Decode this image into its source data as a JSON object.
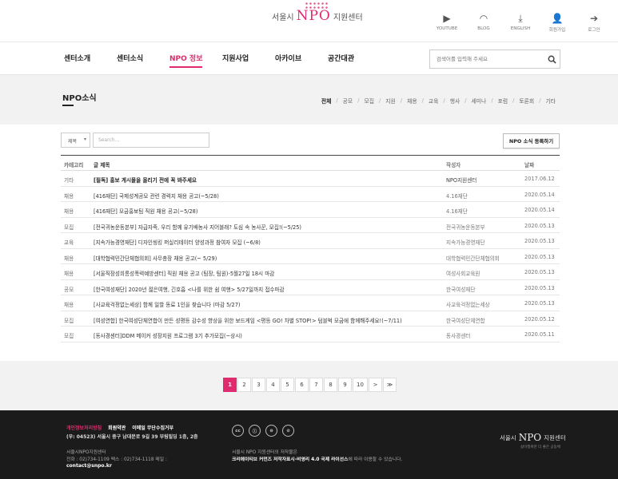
{
  "header": {
    "logo": {
      "prefix": "서울시",
      "npo": "NPO",
      "suffix": "지원센터"
    },
    "util": [
      {
        "label": "YOUTUBE",
        "icon": "youtube-icon",
        "glyph": "▶"
      },
      {
        "label": "BLOG",
        "icon": "rss-icon",
        "glyph": "◠"
      },
      {
        "label": "ENGLISH",
        "icon": "download-icon",
        "glyph": "⤓"
      },
      {
        "label": "회원가입",
        "icon": "add-user-icon",
        "glyph": "👤"
      },
      {
        "label": "로그인",
        "icon": "login-icon",
        "glyph": "➔"
      }
    ]
  },
  "nav": {
    "items": [
      "센터소개",
      "센터소식",
      "NPO 정보",
      "지원사업",
      "아카이브",
      "공간대관"
    ],
    "active": "NPO 정보",
    "search_placeholder": "검색어를 입력해 주세요"
  },
  "section": {
    "title": "NPO소식",
    "categories": [
      "전체",
      "공모",
      "모집",
      "지원",
      "채용",
      "교육",
      "행사",
      "세미나",
      "포럼",
      "토론회",
      "기타"
    ],
    "active_category": "전체"
  },
  "filter": {
    "select_value": "제목",
    "search_placeholder": "Search...",
    "register_button": "NPO 소식 등록하기"
  },
  "table": {
    "headers": {
      "category": "카테고리",
      "title": "글 제목",
      "author": "작성자",
      "date": "날짜"
    },
    "rows": [
      {
        "category": "기타",
        "title": "[필독] 홍보 게시물을 올리기 전에 꼭 봐주세요",
        "author": "NPO지원센터",
        "date": "2017.06.12",
        "notice": true
      },
      {
        "category": "채용",
        "title": "[416재단] 국제성계공모 관련 경력지 채용 공고(~5/28)",
        "author": "4.16재단",
        "date": "2020.05.14"
      },
      {
        "category": "채용",
        "title": "[416재단] 모금홍보팀 직원 채용 공고(~5/28)",
        "author": "4.16재단",
        "date": "2020.05.14"
      },
      {
        "category": "모집",
        "title": "[전국귀농운동본부] 자급자족, 우리 함께 유기배농사 지어볼래? 도심 속 농사꾼, 모집!(~5/25)",
        "author": "전국귀농운동본부",
        "date": "2020.05.13"
      },
      {
        "category": "교육",
        "title": "[지속가능경영재단] 디자인씽킹 퍼실리테이터 양성과정 참여자 모집 (~6/8)",
        "author": "지속가능경영재단",
        "date": "2020.05.13"
      },
      {
        "category": "채용",
        "title": "[대학협력민간단체협의회] 사무총장 채용 공고(~ 5/29)",
        "author": "대학협력민간단체협의회",
        "date": "2020.05.13"
      },
      {
        "category": "채용",
        "title": "[서울직장성희롱성폭력예방센터] 직원 채용 공고 (팀장, 팀원)-5월27일 18시 마감",
        "author": "여성사회교육원",
        "date": "2020.05.13"
      },
      {
        "category": "공모",
        "title": "[한국여성재단] 2020년 젊은여행, 긴호흡 <나를 위한 쉼 여행> 5/27일까지 접수마감",
        "author": "한국여성재단",
        "date": "2020.05.13"
      },
      {
        "category": "채용",
        "title": "[사교육걱정없는세상] 함께 일할 동료 1인을 찾습니다 (마감 5/27)",
        "author": "사교육걱정없는세상",
        "date": "2020.05.13"
      },
      {
        "category": "모집",
        "title": "[여성연합] 한국여성단체연합이 만든 성평등 감수성 향상을 위한 보드게임 <평등 GO! 차별 STOP!> 텀블벅 모금에 함께해주세요!(~7/11)",
        "author": "한국여성단체연합",
        "date": "2020.05.12"
      },
      {
        "category": "모집",
        "title": "[동사경센터]DDM 메이커 성장지원 프로그램 3기 추가모집(~상시)",
        "author": "동사경센터",
        "date": "2020.05.11"
      }
    ]
  },
  "pagination": {
    "pages": [
      "1",
      "2",
      "3",
      "4",
      "5",
      "6",
      "7",
      "8",
      "9",
      "10"
    ],
    "current": "1",
    "next": ">",
    "last": "≫"
  },
  "footer": {
    "links": [
      "개인정보처리방침",
      "회원약관",
      "이메일 무단수집거부"
    ],
    "address": "(우: 04523) 서울시 중구 남대문로 9길 39 부림빌딩 1층, 2층",
    "org": "서울시NPO지원센터",
    "tel": "전화 : 02)734-1109   팩스 : 02)734-1118   메일 :",
    "email": "contact@snpo.kr",
    "cc_icons": [
      "cc",
      "ⓘ",
      "⊜",
      "⊘"
    ],
    "cc_line1": "서울시 NPO 지원센터의 저작물은",
    "cc_line2_bold": "크리에이티브 커먼즈 저작자표시-비영리 4.0 국제 라이선스",
    "cc_line2_rest": "에 따라 이용할 수 있습니다.",
    "logo": {
      "prefix": "서울시",
      "npo": "NPO",
      "suffix": "지원센터"
    },
    "logo_sub": "삶이행복한 더 좋은 공동체"
  },
  "colors": {
    "accent": "#e02b6e",
    "footer_bg": "#1b1b1b",
    "band_bg": "#f2f2f2"
  }
}
